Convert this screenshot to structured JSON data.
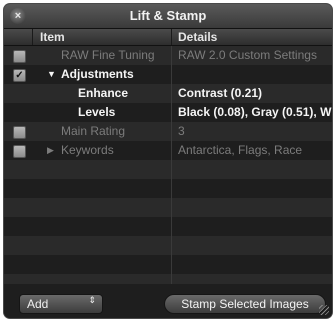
{
  "window": {
    "title": "Lift & Stamp",
    "close_glyph": "×"
  },
  "columns": {
    "item": "Item",
    "details": "Details"
  },
  "rows": [
    {
      "checked": false,
      "indent": 0,
      "disclosure": "",
      "label": "RAW Fine Tuning",
      "details": "RAW 2.0 Custom Settings",
      "style": "dim"
    },
    {
      "checked": true,
      "indent": 0,
      "disclosure": "open",
      "label": "Adjustments",
      "details": "",
      "style": "bright"
    },
    {
      "checked": null,
      "indent": 1,
      "disclosure": "",
      "label": "Enhance",
      "details": "Contrast (0.21)",
      "style": "bright"
    },
    {
      "checked": null,
      "indent": 1,
      "disclosure": "",
      "label": "Levels",
      "details": "Black (0.08), Gray (0.51), W",
      "style": "bright"
    },
    {
      "checked": false,
      "indent": 0,
      "disclosure": "",
      "label": "Main Rating",
      "details": "3",
      "style": "dim"
    },
    {
      "checked": false,
      "indent": 0,
      "disclosure": "closed",
      "label": "Keywords",
      "details": "Antarctica, Flags, Race",
      "style": "dim"
    }
  ],
  "footer": {
    "add_label": "Add",
    "popup_arrows": "⇕",
    "stamp_label": "Stamp Selected Images"
  },
  "icons": {
    "check": "✓",
    "disclosure_open": "▼",
    "disclosure_closed": "▶"
  }
}
